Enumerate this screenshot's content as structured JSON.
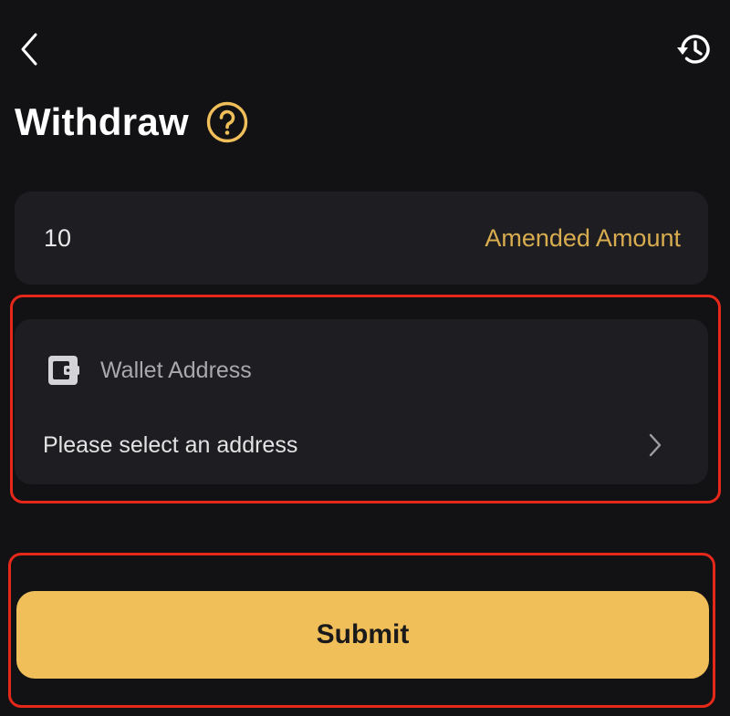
{
  "header": {
    "back_icon": "chevron-left-icon",
    "history_icon": "history-clock-icon"
  },
  "page": {
    "title": "Withdraw",
    "help_icon": "question-circle-icon"
  },
  "amount": {
    "value": "10",
    "label": "Amended Amount"
  },
  "wallet": {
    "icon": "wallet-icon",
    "label": "Wallet Address",
    "placeholder": "Please select an address",
    "chevron_icon": "chevron-right-icon"
  },
  "submit": {
    "label": "Submit"
  },
  "colors": {
    "background": "#121214",
    "card": "#1e1e22",
    "accent": "#f0bf59",
    "accent_text": "#d9ad4f",
    "highlight": "#e6281b"
  }
}
